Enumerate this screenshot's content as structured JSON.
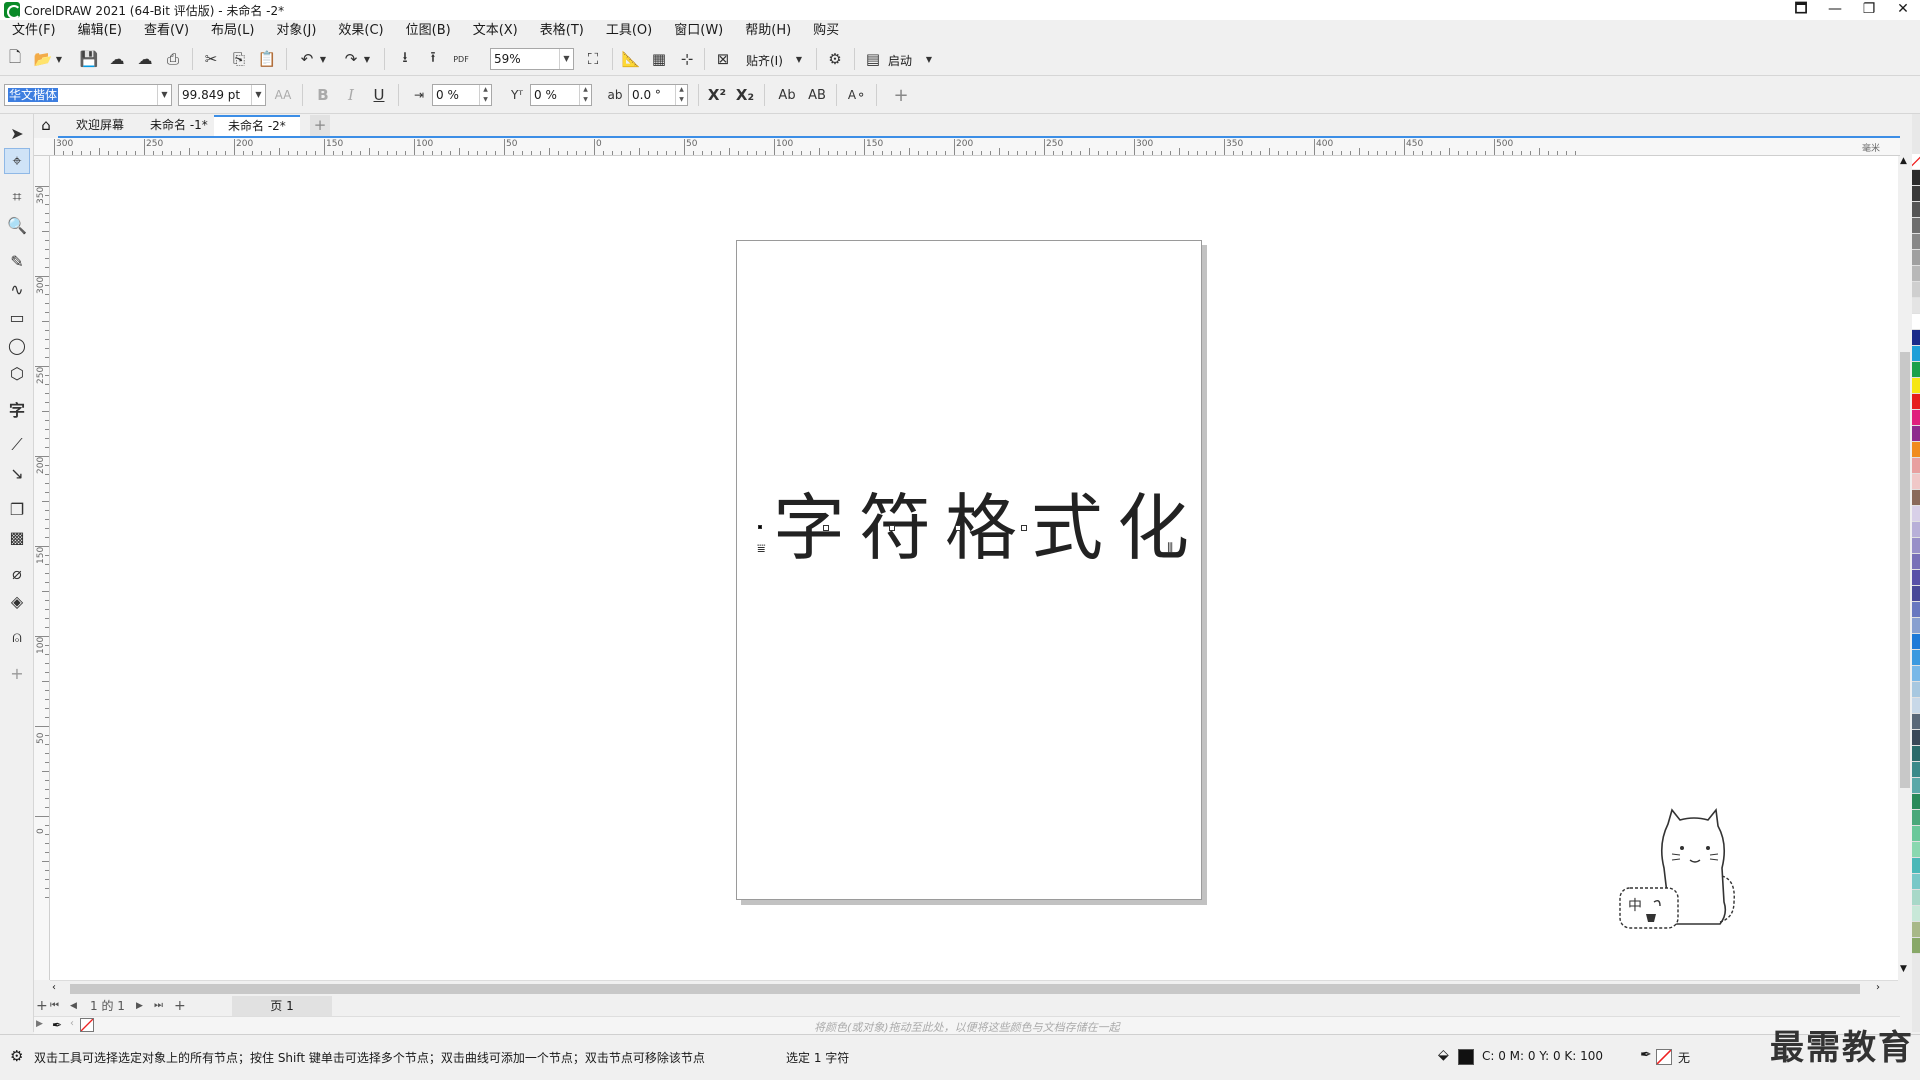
{
  "window": {
    "title": "CorelDRAW 2021 (64-Bit 评估版) - 未命名 -2*",
    "controls": [
      "🗖",
      "—",
      "❐",
      "✕"
    ]
  },
  "menu": [
    "文件(F)",
    "编辑(E)",
    "查看(V)",
    "布局(L)",
    "对象(J)",
    "效果(C)",
    "位图(B)",
    "文本(X)",
    "表格(T)",
    "工具(O)",
    "窗口(W)",
    "帮助(H)",
    "购买"
  ],
  "standard_toolbar": {
    "zoom": "59%",
    "snap_label": "贴齐(I)",
    "launch_label": "启动",
    "pdf_label": "PDF"
  },
  "property_bar": {
    "font_family": "华文楷体",
    "font_size": "99.849 pt",
    "bold": "B",
    "italic": "I",
    "underline": "U",
    "char_spacing": "0 %",
    "baseline_shift": "0 %",
    "rotation": "0.0 °",
    "superscript": "X²",
    "subscript": "X₂",
    "small_caps": "Ab",
    "all_caps": "AB",
    "add": "+"
  },
  "tabs": {
    "home_icon": "home-icon",
    "items": [
      "欢迎屏幕",
      "未命名 -1*",
      "未命名 -2*"
    ],
    "active_index": 2,
    "add": "+"
  },
  "ruler": {
    "horizontal_labels": [
      "300",
      "250",
      "200",
      "150",
      "100",
      "50",
      "0",
      "50",
      "100",
      "150",
      "200",
      "250",
      "300",
      "350",
      "400",
      "450",
      "500"
    ],
    "units": "毫米",
    "vertical_labels": [
      "350",
      "300",
      "250",
      "200",
      "150",
      "100",
      "50",
      "0"
    ]
  },
  "canvas": {
    "text": "字符格式化"
  },
  "mascot": {
    "label": "中"
  },
  "page_nav": {
    "first": "⏮",
    "prev": "◀",
    "page_count": "1 的 1",
    "next": "▶",
    "last": "⏭",
    "add": "+",
    "page_tab": "页 1"
  },
  "color_well": {
    "hint": "将颜色(或对象)拖动至此处，以便将这些颜色与文档存储在一起"
  },
  "status": {
    "hint": "双击工具可选择选定对象上的所有节点；按住 Shift 键单击可选择多个节点；双击曲线可添加一个节点；双击节点可移除该节点",
    "selection": "选定 1 字符",
    "fill_cmyk": "C: 0 M: 0 Y: 0 K: 100",
    "outline": "无"
  },
  "watermark": "最需教育",
  "palette_colors": [
    "#ffffff",
    "#2b2b2b",
    "#3a3a3a",
    "#555555",
    "#6e6e6e",
    "#888888",
    "#a0a0a0",
    "#b8b8b8",
    "#cfcfcf",
    "#e4e4e4",
    "#ffffff",
    "#1a2a8a",
    "#1e9fd8",
    "#1aa04a",
    "#f5e614",
    "#e61e1e",
    "#e0207e",
    "#8e2a8e",
    "#f08c1e",
    "#e8a0a0",
    "#f0c8c8",
    "#8a6a5a",
    "#d8d0e8",
    "#b8b0d8",
    "#9890c8",
    "#7870b8",
    "#5850a8",
    "#484898",
    "#6878c0",
    "#88a0d0",
    "#1e7ad8",
    "#3c9ae0",
    "#78b8e8",
    "#a8c8e0",
    "#c8d8e8",
    "#5a6878",
    "#3a4858",
    "#2a6a6a",
    "#3a8a8a",
    "#5aa8a8",
    "#2a8a5a",
    "#4aa87a",
    "#6ac89a",
    "#8ad8b0",
    "#4ab8b8",
    "#78c8c8",
    "#a8d8c8",
    "#c8e8d8",
    "#a8b888",
    "#88a868"
  ]
}
